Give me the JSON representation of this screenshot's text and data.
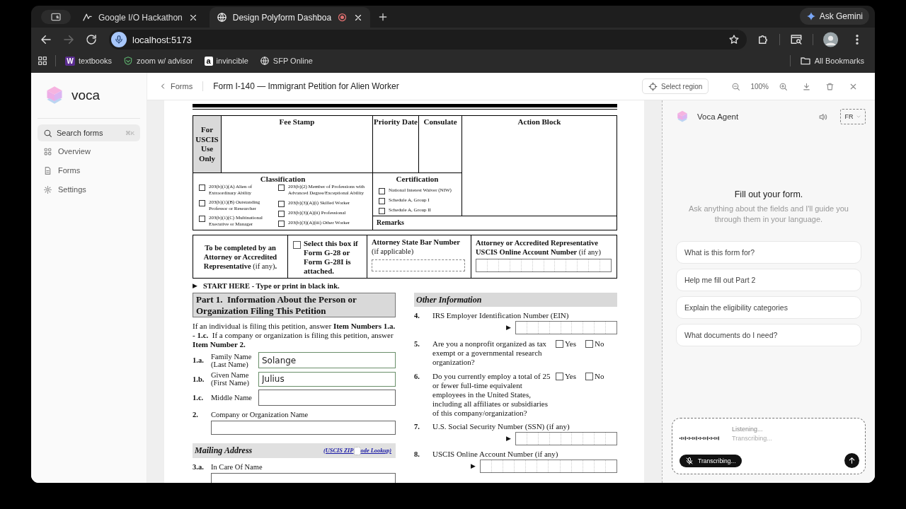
{
  "browser": {
    "tabs": [
      {
        "title": "Google I/O Hackathon",
        "selected": false,
        "recording": false
      },
      {
        "title": "Design Polyform Dashboa",
        "selected": true,
        "recording": true
      }
    ],
    "ask_gemini": "Ask Gemini",
    "nav_buttons": [
      {
        "kind": "back",
        "disabled": false
      },
      {
        "kind": "forward",
        "disabled": true
      },
      {
        "kind": "reload",
        "disabled": false
      }
    ],
    "address": "localhost:5173",
    "bookmarks": [
      {
        "label": "textbooks",
        "kind": "letter",
        "badge": "W"
      },
      {
        "label": "zoom w/ advisor",
        "kind": "shield"
      },
      {
        "label": "invincible",
        "kind": "tile",
        "badge": "a"
      },
      {
        "label": "SFP Online",
        "kind": "globe"
      }
    ],
    "all_bookmarks": "All Bookmarks"
  },
  "sidebar": {
    "brand": "voca",
    "search": {
      "placeholder": "Search forms",
      "shortcut": "⌘K"
    },
    "items": [
      {
        "label": "Overview",
        "kind": "grid",
        "selected": false
      },
      {
        "label": "Forms",
        "kind": "doc",
        "selected": false
      },
      {
        "label": "Settings",
        "kind": "gear",
        "selected": false
      }
    ]
  },
  "header": {
    "back": "Forms",
    "title": "Form I-140 — Immigrant Petition for Alien Worker",
    "select_region": "Select region",
    "zoom": "100%"
  },
  "form": {
    "office": {
      "uscis": "For USCIS Use Only",
      "fee_stamp": "Fee Stamp",
      "priority_date": "Priority Date",
      "consulate": "Consulate",
      "action_block": "Action Block",
      "remarks": "Remarks",
      "classification": {
        "title": "Classification",
        "columns": [
          [
            {
              "label": "203(b)(1)(A) Alien of Extraordinary Ability",
              "checked": false
            },
            {
              "label": "203(b)(1)(B) Outstanding Professor or Researcher",
              "checked": false
            },
            {
              "label": "203(b)(1)(C) Multinational Executive or Manager",
              "checked": false
            }
          ],
          [
            {
              "label": "203(b)(2) Member of Professions with Advanced Degree/Exceptional Ability",
              "checked": false
            },
            {
              "label": "203(b)(3)(A)(i) Skilled Worker",
              "checked": false
            },
            {
              "label": "203(b)(3)(A)(ii) Professional",
              "checked": false
            },
            {
              "label": "203(b)(3)(A)(iii) Other Worker",
              "checked": false
            }
          ]
        ]
      },
      "certification": {
        "title": "Certification",
        "options": [
          {
            "label": "National Interest Waiver (NIW)",
            "checked": false
          },
          {
            "label": "Schedule A, Group I",
            "checked": false
          },
          {
            "label": "Schedule A, Group II",
            "checked": false
          }
        ]
      }
    },
    "attorney": {
      "note": "**To be completed by an Attorney or Accredited Representative** (if any)**.**",
      "g28": {
        "label": "Select this box if Form G-28 or Form G-28I is attached.",
        "checked": false
      },
      "bar_number": {
        "label": "Attorney State Bar Number",
        "note": "(if applicable)"
      },
      "account": {
        "label": "**Attorney or Accredited Representative USCIS Online Account Number** (if any)"
      }
    },
    "start_here": {
      "marker": "▶",
      "text": "START HERE - Type or print in black ink."
    },
    "part1": {
      "title": "Part 1.  Information About the Person or Organization Filing This Petition",
      "intro": "If an individual is filing this petition, answer **Item Numbers 1.a. - 1.c.**  If a company or organization is filing this petition, answer **Item Number 2.**",
      "fields": [
        {
          "number": "1.a.",
          "label": "Family Name (Last Name)",
          "value": "Solange",
          "kind": "inline"
        },
        {
          "number": "1.b.",
          "label": "Given Name (First Name)",
          "value": "Julius",
          "kind": "inline"
        },
        {
          "number": "1.c.",
          "label": "Middle Name",
          "kind": "inline"
        },
        {
          "number": "2.",
          "label": "Company or Organization Name",
          "kind": "below"
        }
      ]
    },
    "mailing": {
      "title": "Mailing Address",
      "link_parts": [
        "(USCIS ZIP",
        "ode Lookup)"
      ],
      "fields": [
        {
          "number": "3.a.",
          "label": "In Care Of Name",
          "kind": "below"
        }
      ]
    },
    "other": {
      "title": "Other Information",
      "items": [
        {
          "number": "4.",
          "label": "IRS Employer Identification Number (EIN)",
          "kind": "comb",
          "arrow": "▶"
        },
        {
          "number": "5.",
          "label": "Are you a nonprofit organized as tax exempt or a governmental research organization?",
          "kind": "yesno",
          "options": [
            {
              "label": "Yes",
              "checked": false
            },
            {
              "label": "No",
              "checked": false
            }
          ]
        },
        {
          "number": "6.",
          "label": "Do you currently employ a total of 25 or fewer full-time equivalent employees in the United States, including all affiliates or subsidiaries of this company/organization?",
          "kind": "yesno",
          "options": [
            {
              "label": "Yes",
              "checked": false
            },
            {
              "label": "No",
              "checked": false
            }
          ]
        },
        {
          "number": "7.",
          "label": "U.S. Social Security Number (SSN) (if any)",
          "kind": "comb",
          "arrow": "▶"
        },
        {
          "number": "8.",
          "label": "USCIS Online Account Number (if any)",
          "kind": "combwide",
          "arrow": "▶"
        }
      ]
    }
  },
  "agent": {
    "name": "Voca Agent",
    "language": "FR",
    "heading": "Fill out your form.",
    "subtitle": "Ask anything about the fields and I'll guide you through them in your language.",
    "suggestions": [
      "What is this form for?",
      "Help me fill out Part 2",
      "Explain the eligibility categories",
      "What documents do I need?"
    ],
    "composer": {
      "status": "Listening...",
      "transcript": "Transcribing...",
      "mic_button": "Transcribing...",
      "listening": true
    }
  }
}
